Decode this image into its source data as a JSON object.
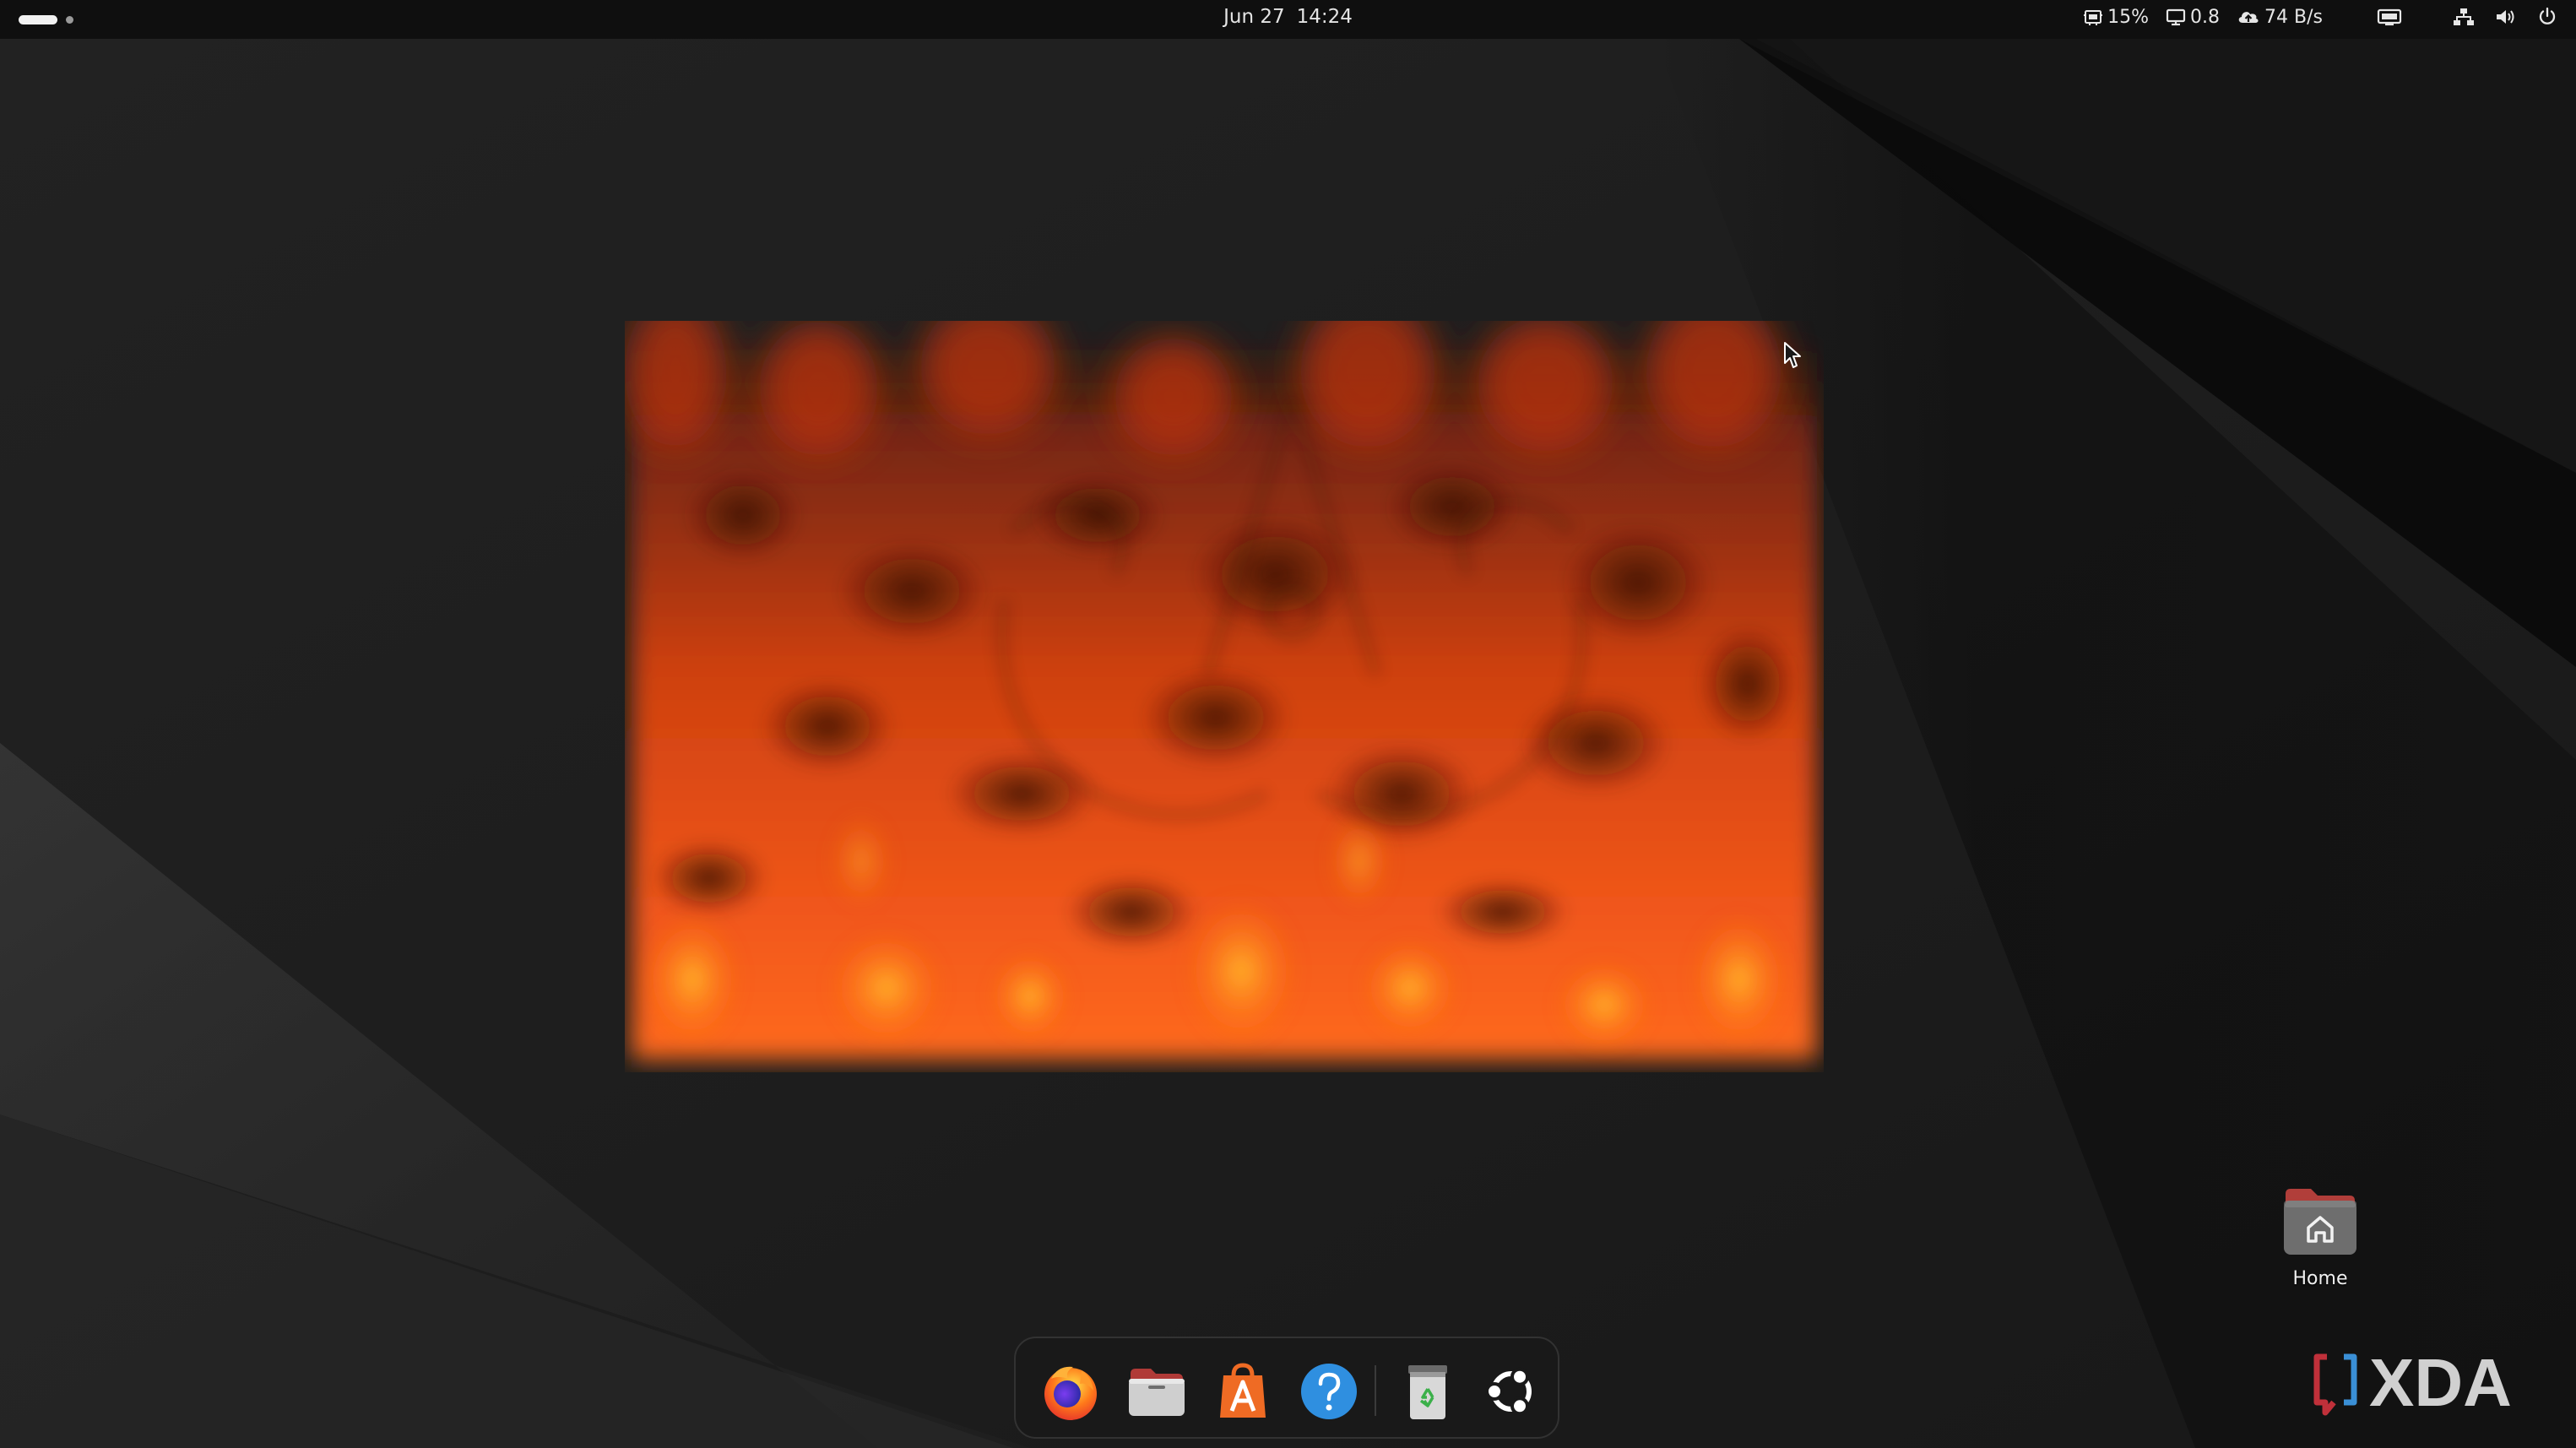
{
  "topbar": {
    "date": "Jun 27",
    "time": "14:24",
    "indicators": {
      "cpu": "15%",
      "load": "0.8",
      "net_speed": "74 B/s"
    },
    "icons": [
      "cpu-monitor-icon",
      "display-icon",
      "cloud-upload-icon",
      "screen-share-icon",
      "network-icon",
      "volume-icon",
      "power-icon"
    ]
  },
  "desktop": {
    "home_label": "Home"
  },
  "dock": {
    "apps": [
      "firefox",
      "files",
      "app-center",
      "help",
      "trash",
      "ubuntu-logo"
    ]
  },
  "watermark": "XDA",
  "colors": {
    "topbar": "#0f0f0f",
    "background": "#1e1e1e",
    "fire": "#ff5a0f",
    "folder": "#d8584e"
  }
}
